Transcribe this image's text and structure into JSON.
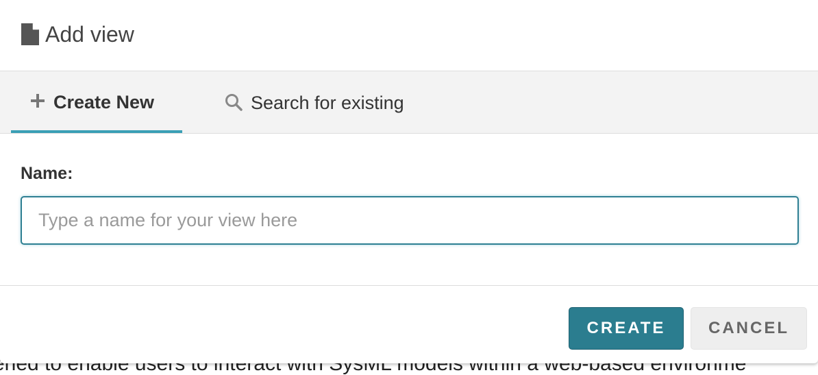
{
  "background": {
    "partial_text": "ened to enable users to interact with SysML models within a web-based environme"
  },
  "modal": {
    "title": "Add view",
    "title_icon": "document-icon",
    "tabs": [
      {
        "label": "Create New",
        "icon": "plus-icon",
        "active": true
      },
      {
        "label": "Search for existing",
        "icon": "search-icon",
        "active": false
      }
    ],
    "form": {
      "name_label": "Name:",
      "name_value": "",
      "name_placeholder": "Type a name for your view here"
    },
    "buttons": {
      "create": "CREATE",
      "cancel": "CANCEL"
    }
  },
  "colors": {
    "accent": "#3a9fb5",
    "primary_button": "#2b7d8f",
    "tab_bar_bg": "#f3f3f3"
  }
}
